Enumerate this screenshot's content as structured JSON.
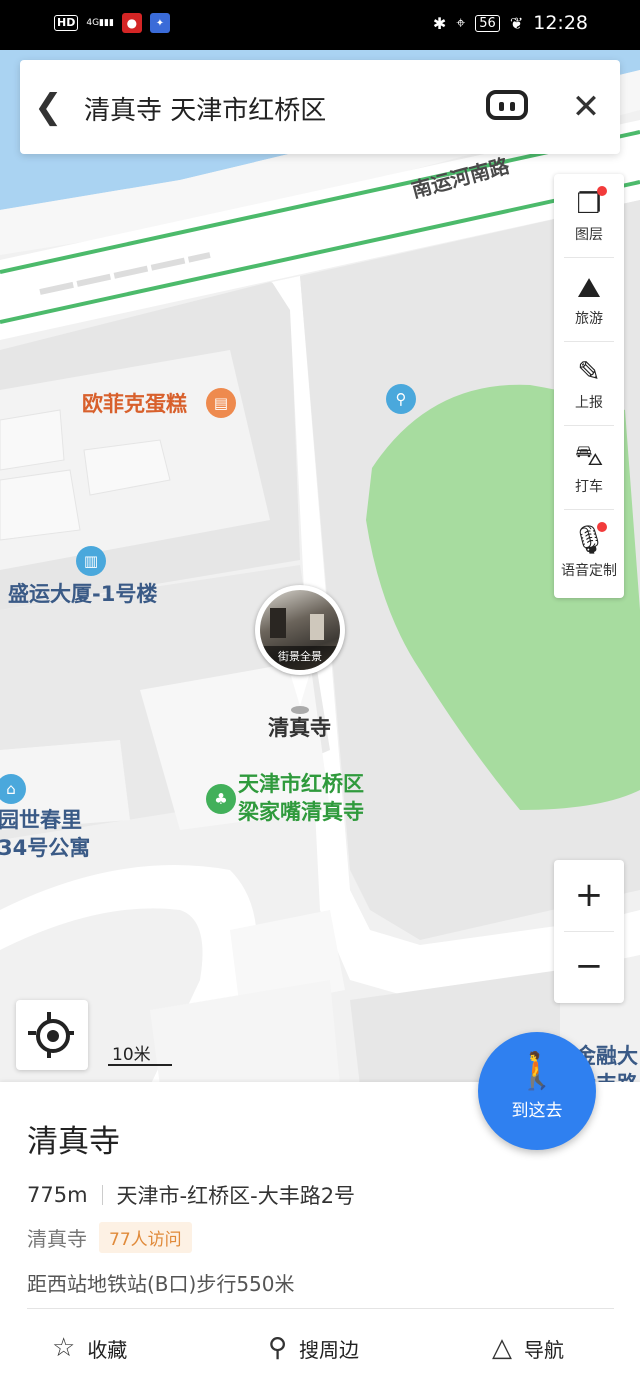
{
  "status_bar": {
    "hd": "HD",
    "signal": "4G",
    "battery": "56",
    "time": "12:28"
  },
  "search": {
    "query": "清真寺 天津市红桥区"
  },
  "tools": [
    {
      "label": "图层",
      "icon": "layers-icon",
      "dot": true
    },
    {
      "label": "旅游",
      "icon": "travel-icon",
      "dot": false
    },
    {
      "label": "上报",
      "icon": "report-icon",
      "dot": false
    },
    {
      "label": "打车",
      "icon": "taxi-icon",
      "dot": false
    },
    {
      "label": "语音定制",
      "icon": "mic-icon",
      "dot": true
    }
  ],
  "map_labels": {
    "road": "南运河南路",
    "cake": "欧菲克蛋糕",
    "shengyun": "盛运大厦-1号楼",
    "qingzhensi": "清真寺",
    "mosque_line1": "天津市红桥区",
    "mosque_line2": "梁家嘴清真寺",
    "shichun_line1": "园世春里",
    "shichun_line2": "34号公寓",
    "jinrong_line1": "金融大",
    "jinrong_line2": "大丰路"
  },
  "street_view": "街景全景",
  "scale": "10米",
  "go_button": "到这去",
  "place": {
    "name": "清真寺",
    "distance": "775m",
    "address": "天津市-红桥区-大丰路2号",
    "category": "清真寺",
    "visits": "77人访问",
    "transit": "距西站地铁站(B口)步行550米"
  },
  "actions": {
    "favorite": "收藏",
    "nearby": "搜周边",
    "navigate": "导航"
  },
  "colors": {
    "accent": "#2f80f0",
    "park": "#a7dc9f",
    "water": "#aad3f2",
    "road_green": "#4cba6b"
  }
}
